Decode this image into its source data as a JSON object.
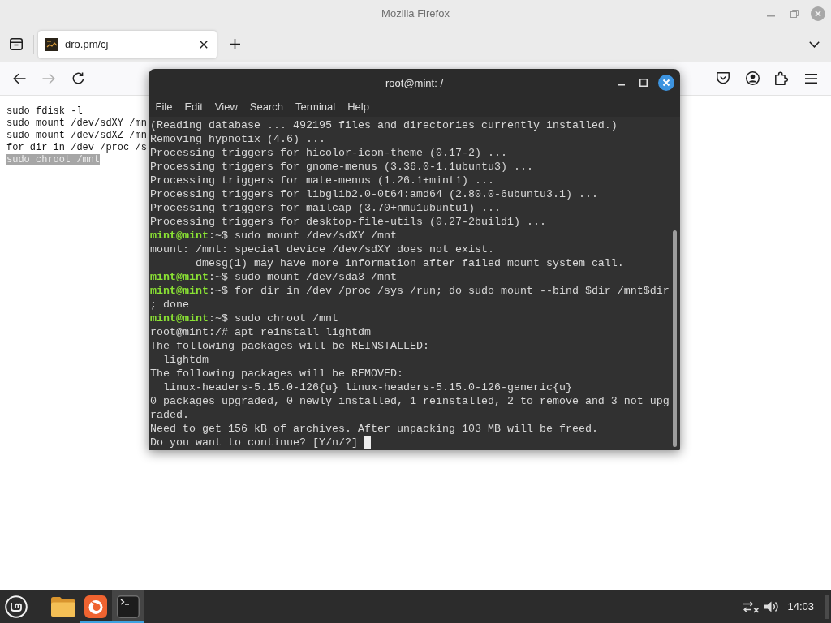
{
  "window": {
    "title": "Mozilla Firefox"
  },
  "tabs": [
    {
      "label": "dro.pm/cj",
      "selected": true
    }
  ],
  "nav_buttons": [
    {
      "kind": "back",
      "disabled": false
    },
    {
      "kind": "forward",
      "disabled": true
    },
    {
      "kind": "reload",
      "disabled": false
    }
  ],
  "page": {
    "lines": [
      {
        "text": "sudo fdisk -l",
        "selected": false
      },
      {
        "text": "sudo mount /dev/sdXY /mn",
        "selected": false
      },
      {
        "text": "sudo mount /dev/sdXZ /mn",
        "selected": false
      },
      {
        "text": "for dir in /dev /proc /s",
        "selected": false
      },
      {
        "text": "sudo chroot /mnt",
        "selected": true
      }
    ]
  },
  "terminal": {
    "title": "root@mint: /",
    "menu": [
      "File",
      "Edit",
      "View",
      "Search",
      "Terminal",
      "Help"
    ],
    "lines": [
      {
        "kind": "output",
        "text": "(Reading database ... 492195 files and directories currently installed.)"
      },
      {
        "kind": "output",
        "text": "Removing hypnotix (4.6) ..."
      },
      {
        "kind": "output",
        "text": "Processing triggers for hicolor-icon-theme (0.17-2) ..."
      },
      {
        "kind": "output",
        "text": "Processing triggers for gnome-menus (3.36.0-1.1ubuntu3) ..."
      },
      {
        "kind": "output",
        "text": "Processing triggers for mate-menus (1.26.1+mint1) ..."
      },
      {
        "kind": "output",
        "text": "Processing triggers for libglib2.0-0t64:amd64 (2.80.0-6ubuntu3.1) ..."
      },
      {
        "kind": "output",
        "text": "Processing triggers for mailcap (3.70+nmu1ubuntu1) ..."
      },
      {
        "kind": "output",
        "text": "Processing triggers for desktop-file-utils (0.27-2build1) ..."
      },
      {
        "kind": "prompt",
        "prompt": "mint@mint",
        "text": ":~$ sudo mount /dev/sdXY /mnt"
      },
      {
        "kind": "output",
        "text": "mount: /mnt: special device /dev/sdXY does not exist."
      },
      {
        "kind": "output",
        "text": "       dmesg(1) may have more information after failed mount system call."
      },
      {
        "kind": "prompt",
        "prompt": "mint@mint",
        "text": ":~$ sudo mount /dev/sda3 /mnt"
      },
      {
        "kind": "prompt",
        "prompt": "mint@mint",
        "text": ":~$ for dir in /dev /proc /sys /run; do sudo mount --bind $dir /mnt$dir"
      },
      {
        "kind": "output",
        "text": "; done"
      },
      {
        "kind": "prompt",
        "prompt": "mint@mint",
        "text": ":~$ sudo chroot /mnt"
      },
      {
        "kind": "output",
        "text": "root@mint:/# apt reinstall lightdm"
      },
      {
        "kind": "output",
        "text": "The following packages will be REINSTALLED:"
      },
      {
        "kind": "output",
        "text": "  lightdm"
      },
      {
        "kind": "output",
        "text": "The following packages will be REMOVED:"
      },
      {
        "kind": "output",
        "text": "  linux-headers-5.15.0-126{u} linux-headers-5.15.0-126-generic{u}"
      },
      {
        "kind": "output",
        "text": "0 packages upgraded, 0 newly installed, 1 reinstalled, 2 to remove and 3 not upg"
      },
      {
        "kind": "output",
        "text": "raded."
      },
      {
        "kind": "output",
        "text": "Need to get 156 kB of archives. After unpacking 103 MB will be freed."
      },
      {
        "kind": "output",
        "text": "Do you want to continue? [Y/n/?]"
      }
    ],
    "cursor": true
  },
  "taskbar": {
    "apps": [
      {
        "kind": "files",
        "running": false,
        "focused": false
      },
      {
        "kind": "browser",
        "running": true,
        "focused": false
      },
      {
        "kind": "terminal",
        "running": true,
        "focused": true
      }
    ],
    "clock": "14:03"
  }
}
